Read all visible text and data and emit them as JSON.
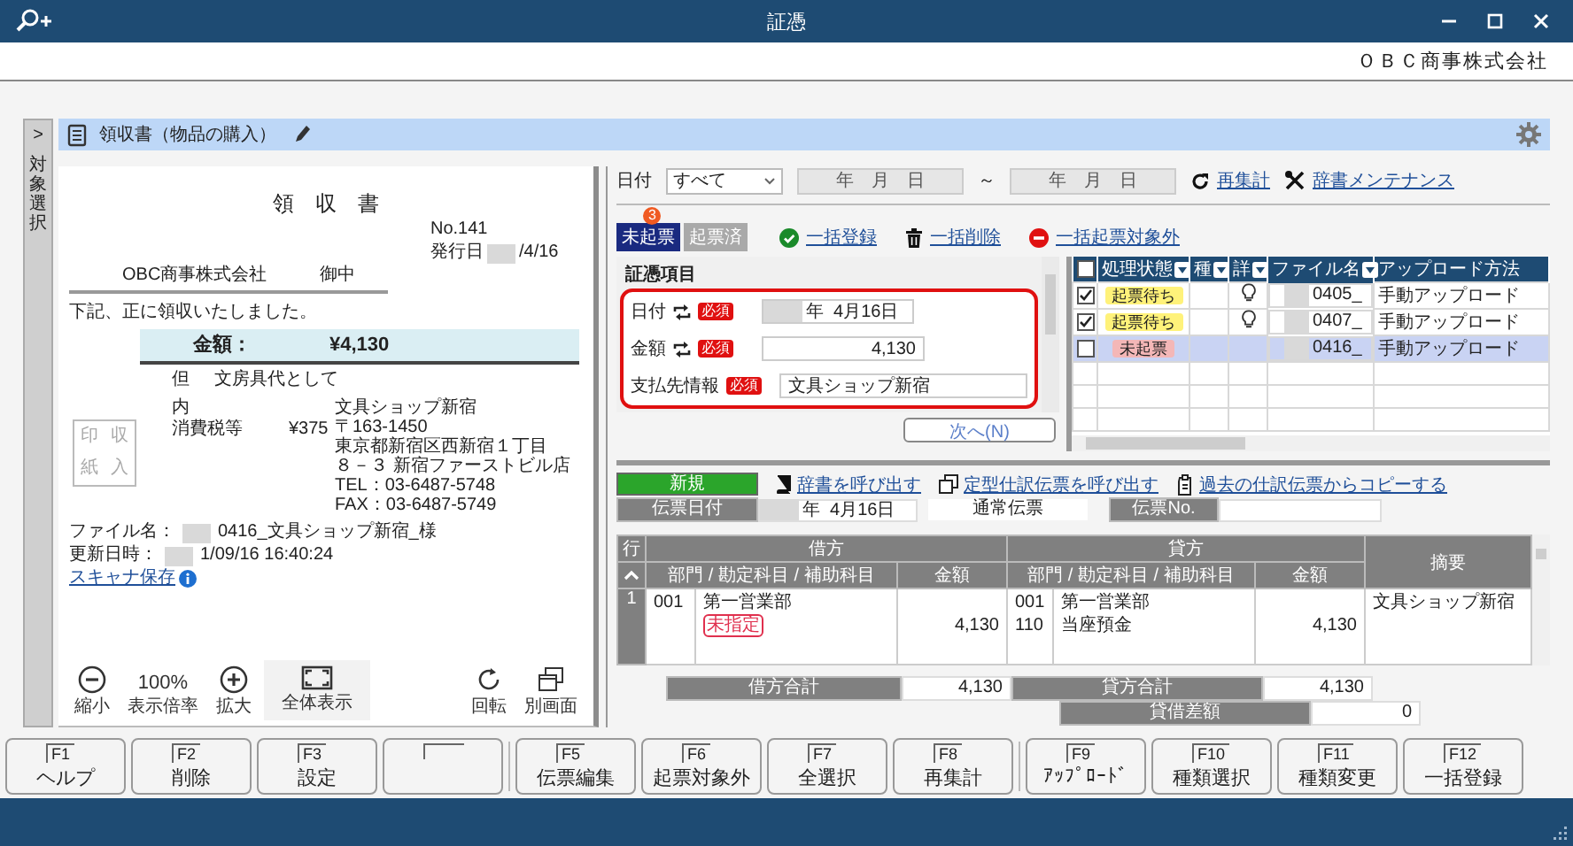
{
  "window": {
    "title": "証憑",
    "company": "ＯＢＣ商事株式会社"
  },
  "side_tab": {
    "arrow": ">",
    "label": "対象選択"
  },
  "document_header": {
    "title": "領収書（物品の購入）"
  },
  "receipt": {
    "title": "領　収　書",
    "number": "No.141",
    "issue_label": "発行日",
    "issue_date": "/4/16",
    "addressee": "OBC商事株式会社",
    "honorific": "御中",
    "statement": "下記、正に領収いたしました。",
    "amount_label": "金額：",
    "amount": "¥4,130",
    "note_prefix": "但",
    "note": "文房具代として",
    "breakdown_label": "内",
    "tax_label": "消費税等",
    "tax": "¥375",
    "stamp": [
      "印",
      "収",
      "紙",
      "入"
    ],
    "issuer": [
      "文具ショップ新宿",
      "〒163-1450",
      "東京都新宿区西新宿１丁目",
      "８－３ 新宿ファーストビル店",
      "TEL：03-6487-5748",
      "FAX：03-6487-5749"
    ]
  },
  "file_info": {
    "name_label": "ファイル名：",
    "name": "0416_文具ショップ新宿_様",
    "updated_label": "更新日時：",
    "updated": "1/09/16 16:40:24",
    "scanner_link": "スキャナ保存"
  },
  "viewer_tools_left": [
    {
      "kind": "zoom-out",
      "label": "縮小"
    },
    {
      "kind": "level",
      "value": "100%",
      "label": "表示倍率"
    },
    {
      "kind": "zoom-in",
      "label": "拡大"
    },
    {
      "kind": "fit",
      "label": "全体表示"
    }
  ],
  "viewer_tools_right": [
    {
      "kind": "rotate",
      "label": "回転"
    },
    {
      "kind": "window",
      "label": "別画面"
    }
  ],
  "filter": {
    "date_label": "日付",
    "period": "すべて",
    "from": "年　月　日",
    "separator": "～",
    "to": "年　月　日"
  },
  "filter_links": [
    {
      "kind": "refresh",
      "label": "再集計"
    },
    {
      "kind": "tools",
      "label": "辞書メンテナンス"
    }
  ],
  "status_tabs": [
    {
      "label": "未起票",
      "selected": true,
      "badge": "3"
    },
    {
      "label": "起票済",
      "selected": false
    }
  ],
  "bulk_actions": [
    {
      "kind": "check",
      "label": "一括登録"
    },
    {
      "kind": "trash",
      "label": "一括削除"
    },
    {
      "kind": "exclude",
      "label": "一括起票対象外"
    }
  ],
  "evidence": {
    "title": "証憑項目",
    "next_button": "次へ(N)",
    "fields": [
      {
        "kind": "date",
        "label": "日付",
        "sync": true,
        "required": "必須",
        "value": "年  4月16日"
      },
      {
        "kind": "amount",
        "label": "金額",
        "sync": true,
        "required": "必須",
        "value": "4,130"
      },
      {
        "kind": "text",
        "label": "支払先情報",
        "sync": false,
        "required": "必須",
        "value": "文具ショップ新宿"
      }
    ]
  },
  "files": {
    "all_checked": false,
    "columns": [
      {
        "label": "処理状態",
        "filter": true
      },
      {
        "label": "種",
        "filter": true
      },
      {
        "label": "詳",
        "filter": true
      },
      {
        "label": "ファイル名",
        "filter": true
      },
      {
        "label": "アップロード方法",
        "filter": false
      }
    ],
    "rows": [
      {
        "checked": true,
        "status": "起票待ち",
        "color": "#fff27a",
        "hint": true,
        "file": "0405_",
        "method": "手動アップロード",
        "selected": false
      },
      {
        "checked": true,
        "status": "起票待ち",
        "color": "#fff27a",
        "hint": true,
        "file": "0407_",
        "method": "手動アップロード",
        "selected": false
      },
      {
        "checked": false,
        "status": "未起票",
        "color": "#f4b7b7",
        "hint": false,
        "file": "0416_",
        "method": "手動アップロード",
        "selected": true
      }
    ]
  },
  "journal": {
    "mode": "新規",
    "links": [
      {
        "kind": "book",
        "label": "辞書を呼び出す"
      },
      {
        "kind": "copy",
        "label": "定型仕訳伝票を呼び出す"
      },
      {
        "kind": "clipboard",
        "label": "過去の仕訳伝票からコピーする"
      }
    ],
    "date_label": "伝票日付",
    "date": "年  4月16日",
    "type": "通常伝票",
    "number_label": "伝票No.",
    "row_header": "行",
    "debit_header": "借方",
    "credit_header": "貸方",
    "debit_account_header": "部門 / 勘定科目 / 補助科目",
    "debit_amount_header": "金額",
    "credit_account_header": "部門 / 勘定科目 / 補助科目",
    "credit_amount_header": "金額",
    "memo_header": "摘要",
    "rows": [
      {
        "line": "1",
        "debit_dept_code": "001",
        "debit_dept": "第一営業部",
        "debit_account_tag": "未指定",
        "debit_amount": "4,130",
        "credit_dept_code": "001",
        "credit_dept": "第一営業部",
        "credit_account_code": "110",
        "credit_account": "当座預金",
        "credit_amount": "4,130",
        "memo": "文具ショップ新宿"
      }
    ],
    "totals": {
      "debit_label": "借方合計",
      "debit": "4,130",
      "credit_label": "貸方合計",
      "credit": "4,130",
      "diff_label": "貸借差額",
      "diff": "0"
    }
  },
  "function_keys": [
    {
      "kind": "key",
      "key": "F1",
      "label": "ヘルプ"
    },
    {
      "kind": "key",
      "key": "F2",
      "label": "削除"
    },
    {
      "kind": "key",
      "key": "F3",
      "label": "設定"
    },
    {
      "kind": "blank"
    },
    {
      "kind": "key",
      "key": "F5",
      "label": "伝票編集"
    },
    {
      "kind": "key",
      "key": "F6",
      "label": "起票対象外"
    },
    {
      "kind": "key",
      "key": "F7",
      "label": "全選択"
    },
    {
      "kind": "key",
      "key": "F8",
      "label": "再集計"
    },
    {
      "kind": "key",
      "key": "F9",
      "label": "ｱｯﾌﾟﾛｰﾄﾞ"
    },
    {
      "kind": "key",
      "key": "F10",
      "label": "種類選択"
    },
    {
      "kind": "key",
      "key": "F11",
      "label": "種類変更"
    },
    {
      "kind": "key",
      "key": "F12",
      "label": "一括登録"
    }
  ]
}
